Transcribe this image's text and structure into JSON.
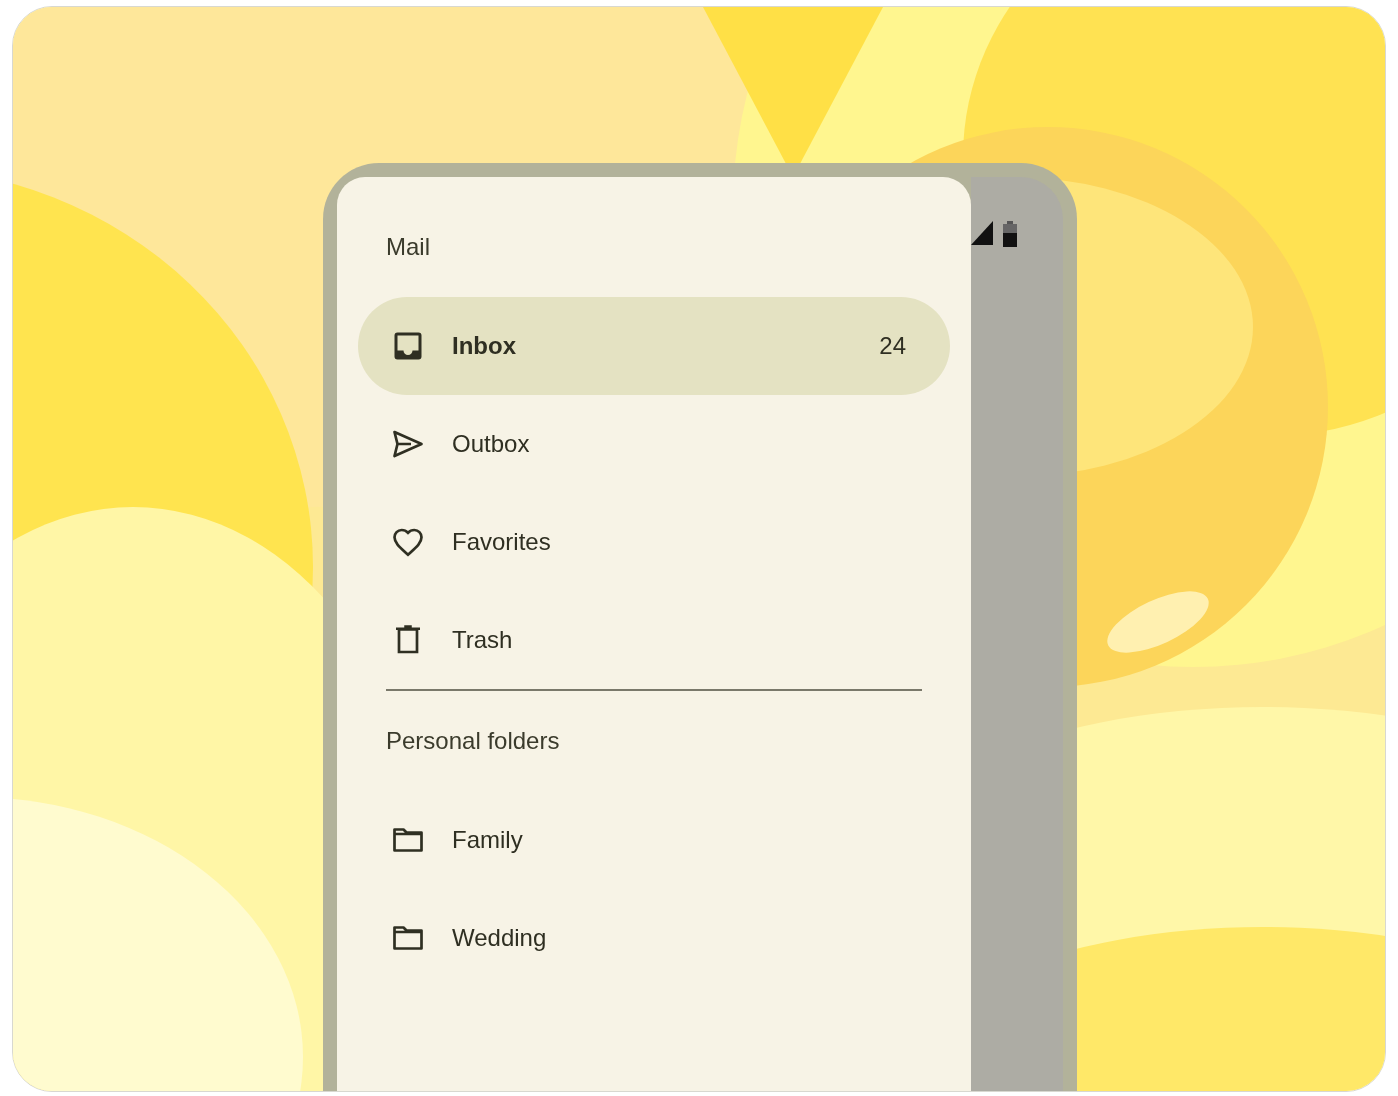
{
  "drawer": {
    "title": "Mail",
    "items": [
      {
        "label": "Inbox",
        "selected": true,
        "badge": "24"
      },
      {
        "label": "Outbox",
        "selected": false
      },
      {
        "label": "Favorites",
        "selected": false
      },
      {
        "label": "Trash",
        "selected": false
      }
    ],
    "section_title": "Personal folders",
    "folders": [
      {
        "label": "Family",
        "selected": false
      },
      {
        "label": "Wedding",
        "selected": false
      }
    ]
  }
}
